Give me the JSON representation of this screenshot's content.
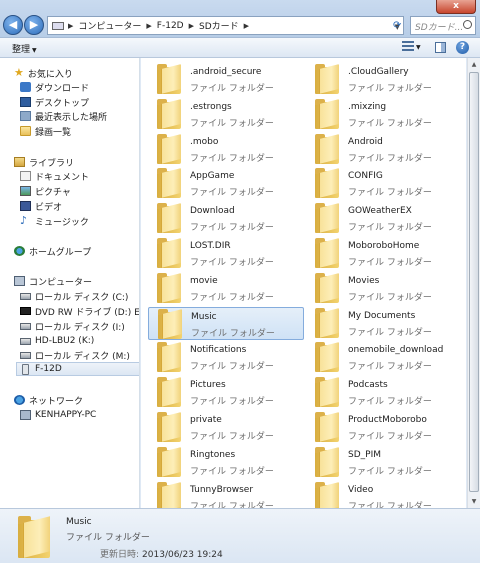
{
  "window": {
    "close_label": "x",
    "back_label": "◀",
    "forward_label": "▶"
  },
  "address": {
    "segments": [
      "コンピューター",
      "F-12D",
      "SDカード"
    ]
  },
  "search": {
    "placeholder": "SDカード..."
  },
  "toolbar": {
    "organize_label": "整理"
  },
  "nav": {
    "favorites": {
      "label": "お気に入り",
      "items": [
        "ダウンロード",
        "デスクトップ",
        "最近表示した場所",
        "録画一覧"
      ]
    },
    "libraries": {
      "label": "ライブラリ",
      "items": [
        "ドキュメント",
        "ピクチャ",
        "ビデオ",
        "ミュージック"
      ]
    },
    "homegroup": {
      "label": "ホームグループ"
    },
    "computer": {
      "label": "コンピューター",
      "items": [
        "ローカル ディスク (C:)",
        "DVD RW ドライブ (D:) EXPAN",
        "ローカル ディスク (I:)",
        "HD-LBU2 (K:)",
        "ローカル ディスク (M:)",
        "F-12D"
      ]
    },
    "network": {
      "label": "ネットワーク",
      "items": [
        "KENHAPPY-PC"
      ]
    }
  },
  "files": {
    "type_label": "ファイル フォルダー",
    "items": [
      ".android_secure",
      ".CloudGallery",
      ".estrongs",
      ".mixzing",
      ".mobo",
      "Android",
      "AppGame",
      "CONFIG",
      "Download",
      "GOWeatherEX",
      "LOST.DIR",
      "MoboroboHome",
      "movie",
      "Movies",
      "Music",
      "My Documents",
      "Notifications",
      "onemobile_download",
      "Pictures",
      "Podcasts",
      "private",
      "ProductMoborobo",
      "Ringtones",
      "SD_PIM",
      "TunnyBrowser",
      "Video"
    ],
    "selected": "Music"
  },
  "details": {
    "name": "Music",
    "type": "ファイル フォルダー",
    "date_label": "更新日時:",
    "date_value": "2013/06/23 19:24"
  }
}
